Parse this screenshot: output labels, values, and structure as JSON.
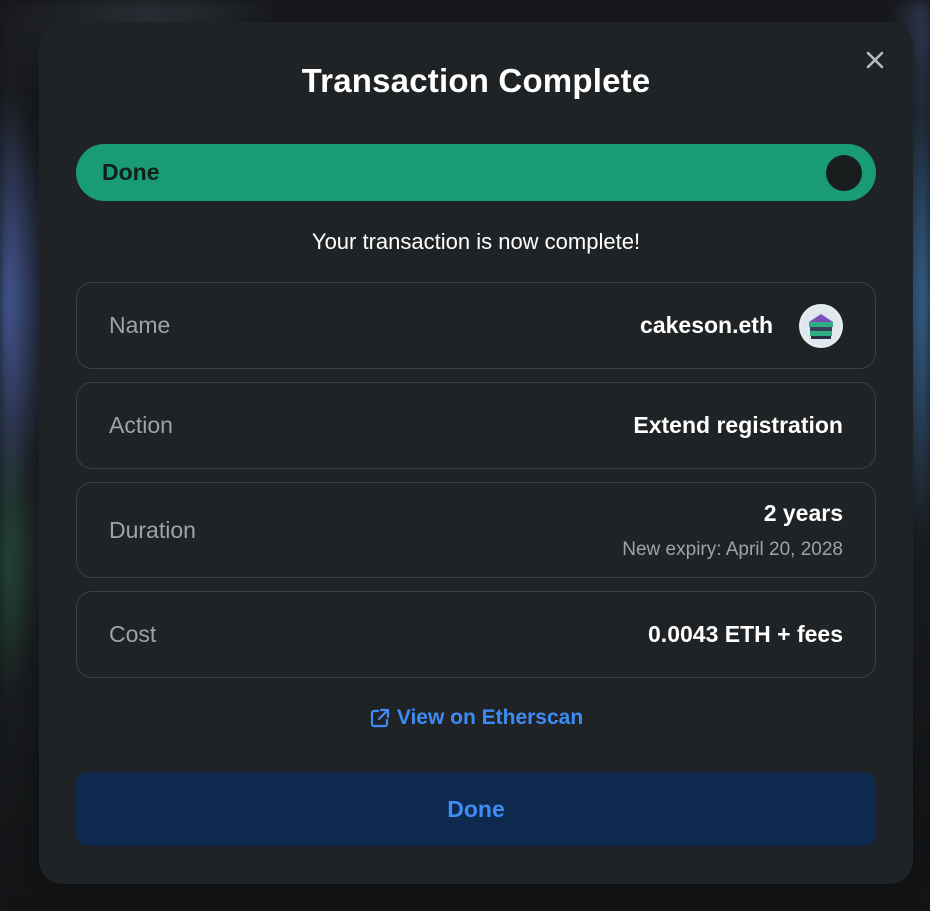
{
  "dialog": {
    "title": "Transaction Complete",
    "progress_label": "Done",
    "progress_percent": 100,
    "message": "Your transaction is now complete!"
  },
  "details": {
    "name": {
      "label": "Name",
      "value": "cakeson.eth"
    },
    "action": {
      "label": "Action",
      "value": "Extend registration"
    },
    "duration": {
      "label": "Duration",
      "value": "2 years",
      "sub": "New expiry: April 20, 2028"
    },
    "cost": {
      "label": "Cost",
      "value": "0.0043 ETH + fees"
    }
  },
  "links": {
    "etherscan_label": "View on Etherscan"
  },
  "buttons": {
    "done_label": "Done"
  },
  "colors": {
    "accent_green": "#199c75",
    "link_blue": "#3d8bf5",
    "button_bg": "#0e284e",
    "modal_bg": "#202325"
  },
  "icons": {
    "close": "close-icon",
    "external_link": "external-link-icon",
    "avatar": "name-avatar-icon"
  }
}
